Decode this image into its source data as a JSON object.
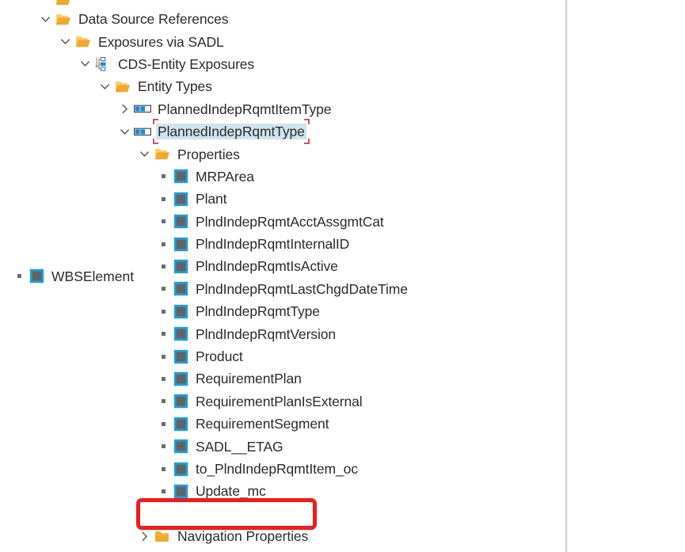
{
  "panel": {
    "name": "project-explorer-tree",
    "divider_color": "#c8c8c8"
  },
  "colors": {
    "folder_open": "#f0a830",
    "folder_open_light": "#ffcc63",
    "folder_closed": "#f0a830",
    "entity_icon_blue": "#1e8ad6",
    "property_icon_border": "#1e9de0",
    "property_icon_fill": "#636363",
    "selection_fill": "#cfe4ef",
    "selection_bracket": "#d2505a",
    "annotation_red": "#ef1c1c",
    "text": "#2b2b2b",
    "chevron": "#5a5a5a"
  },
  "tree": {
    "partial_top_row": {
      "icon": "folder-open-icon",
      "label": ""
    },
    "rows": [
      {
        "id": "data-source-references",
        "label": "Data Source References",
        "icon": "folder-open-icon",
        "twisty": "expanded",
        "depth": 0,
        "type": "folder"
      },
      {
        "id": "exposures-via-sadl",
        "label": "Exposures via SADL",
        "icon": "folder-open-icon",
        "twisty": "expanded",
        "depth": 1,
        "type": "folder"
      },
      {
        "id": "cds-entity-exposures",
        "label": "CDS-Entity Exposures",
        "icon": "cds-entity-hierarchy-icon",
        "twisty": "expanded",
        "depth": 2,
        "type": "node"
      },
      {
        "id": "entity-types",
        "label": "Entity Types",
        "icon": "folder-open-icon",
        "twisty": "expanded",
        "depth": 3,
        "type": "folder"
      },
      {
        "id": "planned-indep-rqmt-item-type",
        "label": "PlannedIndepRqmtItemType",
        "icon": "entity-type-icon",
        "twisty": "collapsed",
        "depth": 4,
        "type": "entity"
      },
      {
        "id": "planned-indep-rqmt-type",
        "label": "PlannedIndepRqmtType",
        "icon": "entity-type-icon",
        "twisty": "expanded",
        "depth": 4,
        "type": "entity",
        "selected": true
      },
      {
        "id": "properties",
        "label": "Properties",
        "icon": "folder-open-icon",
        "twisty": "expanded",
        "depth": 5,
        "type": "folder"
      },
      {
        "id": "prop-mrparea",
        "label": "MRPArea",
        "icon": "property-icon",
        "twisty": "none",
        "depth": 6,
        "type": "property"
      },
      {
        "id": "prop-plant",
        "label": "Plant",
        "icon": "property-icon",
        "twisty": "none",
        "depth": 6,
        "type": "property"
      },
      {
        "id": "prop-plndindeprqmtacctassgmtcat",
        "label": "PlndIndepRqmtAcctAssgmtCat",
        "icon": "property-icon",
        "twisty": "none",
        "depth": 6,
        "type": "property"
      },
      {
        "id": "prop-plndindeprqmtinternalid",
        "label": "PlndIndepRqmtInternalID",
        "icon": "property-icon",
        "twisty": "none",
        "depth": 6,
        "type": "property"
      },
      {
        "id": "prop-plndindeprqmtisactive",
        "label": "PlndIndepRqmtIsActive",
        "icon": "property-icon",
        "twisty": "none",
        "depth": 6,
        "type": "property"
      },
      {
        "id": "prop-plndindeprqmtlastchgddatetime",
        "label": "PlndIndepRqmtLastChgdDateTime",
        "icon": "property-icon",
        "twisty": "none",
        "depth": 6,
        "type": "property"
      },
      {
        "id": "prop-plndindeprqmttype",
        "label": "PlndIndepRqmtType",
        "icon": "property-icon",
        "twisty": "none",
        "depth": 6,
        "type": "property"
      },
      {
        "id": "prop-plndindeprqmtversion",
        "label": "PlndIndepRqmtVersion",
        "icon": "property-icon",
        "twisty": "none",
        "depth": 6,
        "type": "property"
      },
      {
        "id": "prop-product",
        "label": "Product",
        "icon": "property-icon",
        "twisty": "none",
        "depth": 6,
        "type": "property"
      },
      {
        "id": "prop-requirementplan",
        "label": "RequirementPlan",
        "icon": "property-icon",
        "twisty": "none",
        "depth": 6,
        "type": "property"
      },
      {
        "id": "prop-requirementplanisexternal",
        "label": "RequirementPlanIsExternal",
        "icon": "property-icon",
        "twisty": "none",
        "depth": 6,
        "type": "property"
      },
      {
        "id": "prop-requirementsegment",
        "label": "RequirementSegment",
        "icon": "property-icon",
        "twisty": "none",
        "depth": 6,
        "type": "property"
      },
      {
        "id": "prop-sadl-etag",
        "label": "SADL__ETAG",
        "icon": "property-icon",
        "twisty": "none",
        "depth": 6,
        "type": "property"
      },
      {
        "id": "prop-to-plndindeprqmtitem-oc",
        "label": "to_PlndIndepRqmtItem_oc",
        "icon": "property-icon",
        "twisty": "none",
        "depth": 6,
        "type": "property"
      },
      {
        "id": "prop-update-mc",
        "label": "Update_mc",
        "icon": "property-icon",
        "twisty": "none",
        "depth": 6,
        "type": "property"
      },
      {
        "id": "prop-wbselement",
        "label": "WBSElement",
        "icon": "property-icon",
        "twisty": "none",
        "depth": 6,
        "type": "property",
        "annotated": true
      },
      {
        "id": "navigation-properties",
        "label": "Navigation Properties",
        "icon": "folder-closed-icon",
        "twisty": "collapsed",
        "depth": 5,
        "type": "folder"
      }
    ]
  },
  "annotation": {
    "name": "red-highlight-box",
    "target_label": "WBSElement",
    "color": "#ef1c1c"
  }
}
